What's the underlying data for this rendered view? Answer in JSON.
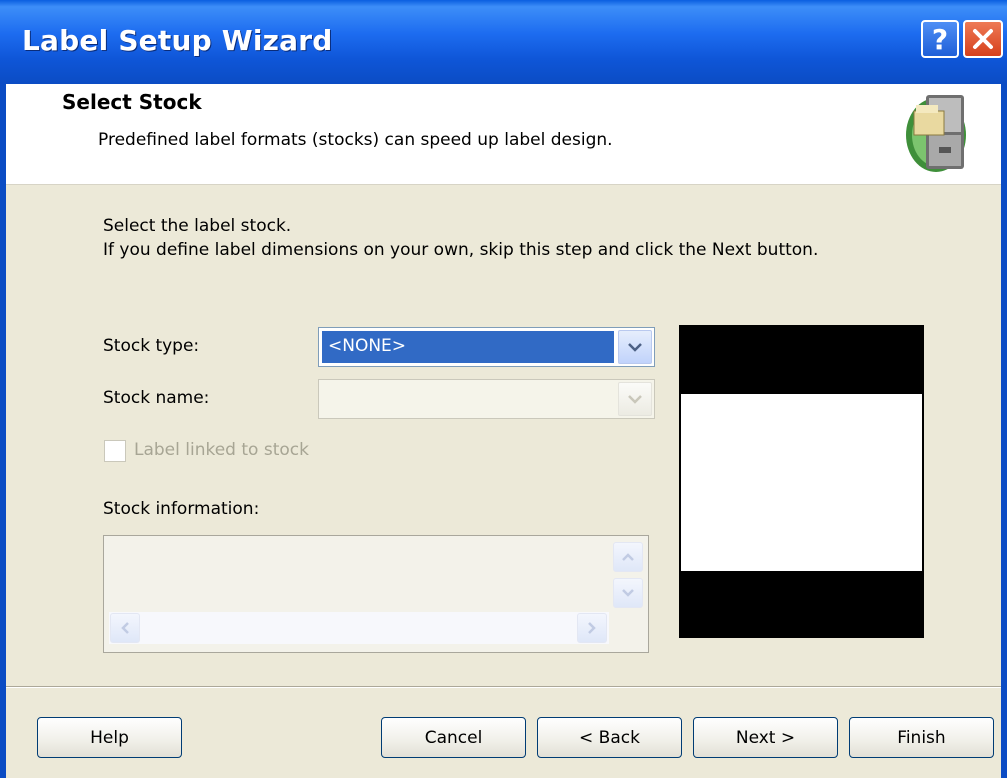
{
  "window": {
    "title": "Label Setup Wizard",
    "help_button": "?"
  },
  "header": {
    "title": "Select Stock",
    "subtitle": "Predefined label formats (stocks) can speed up label design."
  },
  "instructions": {
    "line1": "Select the label stock.",
    "line2": "If you define label dimensions on your own, skip this step and click the Next button."
  },
  "form": {
    "stock_type_label": "Stock type:",
    "stock_type_value": "<NONE>",
    "stock_name_label": "Stock name:",
    "stock_name_value": "",
    "linked_checkbox_label": "Label linked to stock",
    "linked_checked": false,
    "stock_info_label": "Stock information:"
  },
  "buttons": {
    "help": "Help",
    "cancel": "Cancel",
    "back": "< Back",
    "next": "Next >",
    "finish": "Finish"
  },
  "icons": {
    "help": "question-icon",
    "close": "close-icon",
    "header": "file-cabinet-icon"
  },
  "colors": {
    "titlebar": "#0b4cc4",
    "selection": "#316ac5",
    "close": "#d6401c"
  }
}
